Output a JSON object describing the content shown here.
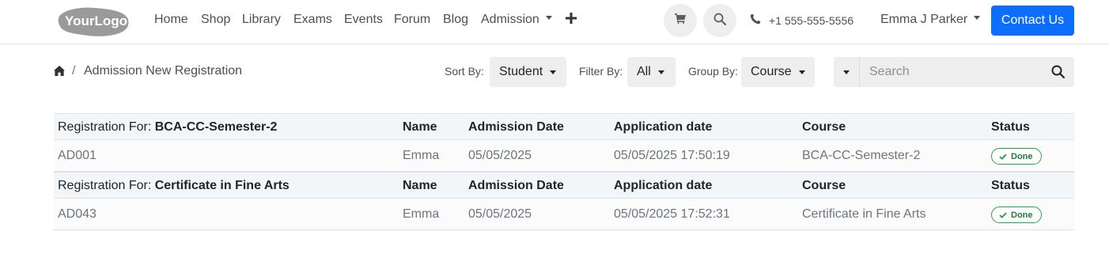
{
  "navbar": {
    "logo_text": "YourLogo",
    "links": [
      "Home",
      "Shop",
      "Library",
      "Exams",
      "Events",
      "Forum",
      "Blog"
    ],
    "admission_label": "Admission",
    "phone": "+1 555-555-5556",
    "user_name": "Emma J Parker",
    "contact_label": "Contact Us"
  },
  "breadcrumb": {
    "current": "Admission New Registration"
  },
  "controls": {
    "sort_label": "Sort By:",
    "sort_value": "Student",
    "filter_label": "Filter By:",
    "filter_value": "All",
    "group_label": "Group By:",
    "group_value": "Course",
    "search_placeholder": "Search"
  },
  "table": {
    "columns": [
      "Name",
      "Admission Date",
      "Application date",
      "Course",
      "Status"
    ],
    "groups": [
      {
        "prefix": "Registration For: ",
        "name": "BCA-CC-Semester-2",
        "rows": [
          {
            "id": "AD001",
            "name": "Emma",
            "admission_date": "05/05/2025",
            "application_date": "05/05/2025 17:50:19",
            "course": "BCA-CC-Semester-2",
            "status": "Done"
          }
        ]
      },
      {
        "prefix": "Registration For: ",
        "name": "Certificate in Fine Arts",
        "rows": [
          {
            "id": "AD043",
            "name": "Emma",
            "admission_date": "05/05/2025",
            "application_date": "05/05/2025 17:52:31",
            "course": "Certificate in Fine Arts",
            "status": "Done"
          }
        ]
      }
    ]
  },
  "colors": {
    "primary": "#0d6efd",
    "status_done": "#28a745"
  }
}
